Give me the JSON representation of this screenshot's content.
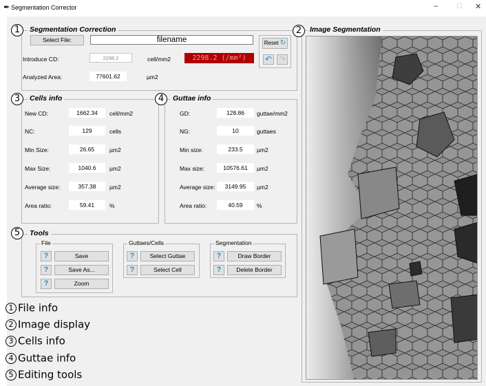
{
  "window": {
    "title": "Segmentation Corrector",
    "minimize": "–",
    "maximize": "□",
    "close": "✕"
  },
  "segmentation": {
    "title": "Segmentation Correction",
    "select_file": "Select File:",
    "filename": "filename",
    "introduce_cd_label": "Introduce CD:",
    "cd_placeholder": "2298.2",
    "cd_unit": "cell/mm2",
    "cd_display": "2298.2 (/mm²)",
    "reset": "Reset",
    "analyzed_area_label": "Analyzed Area:",
    "analyzed_area_value": "77601.62",
    "analyzed_area_unit": "µm2"
  },
  "cells": {
    "title": "Cells info",
    "rows": [
      {
        "label": "New CD:",
        "value": "1662.34",
        "unit": "cell/mm2"
      },
      {
        "label": "NC:",
        "value": "129",
        "unit": "cells"
      },
      {
        "label": "Min Size:",
        "value": "26.65",
        "unit": "µm2"
      },
      {
        "label": "Max Size:",
        "value": "1040.6",
        "unit": "µm2"
      },
      {
        "label": "Average size:",
        "value": "357.38",
        "unit": "µm2"
      },
      {
        "label": "Area ratio:",
        "value": "59.41",
        "unit": "%"
      }
    ]
  },
  "guttae": {
    "title": "Guttae info",
    "rows": [
      {
        "label": "GD:",
        "value": "128.86",
        "unit": "guttae/mm2"
      },
      {
        "label": "NG:",
        "value": "10",
        "unit": "guttaes"
      },
      {
        "label": "Min size:",
        "value": "233.5",
        "unit": "µm2"
      },
      {
        "label": "Max size:",
        "value": "10576.61",
        "unit": "µm2"
      },
      {
        "label": "Average size:",
        "value": "3149.95",
        "unit": "µm2"
      },
      {
        "label": "Area ratio:",
        "value": "40.59",
        "unit": "%"
      }
    ]
  },
  "tools": {
    "title": "Tools",
    "file_group": "File",
    "save": "Save",
    "save_as": "Save As...",
    "zoom": "Zoom",
    "gc_group": "Guttaes/Cells",
    "select_guttae": "Select Guttae",
    "select_cell": "Select Cell",
    "seg_group": "Segmentation",
    "draw_border": "Draw Border",
    "delete_border": "Delete Border",
    "help": "?"
  },
  "image_panel": {
    "title": "Image Segmentation"
  },
  "markers": [
    "1",
    "2",
    "3",
    "4",
    "5"
  ],
  "legend": [
    {
      "num": "1",
      "text": "File info"
    },
    {
      "num": "2",
      "text": "Image display"
    },
    {
      "num": "3",
      "text": "Cells info"
    },
    {
      "num": "4",
      "text": "Guttae info"
    },
    {
      "num": "5",
      "text": "Editing tools"
    }
  ],
  "colors": {
    "cd_display_bg": "#b00000",
    "help_icon": "#1a8fd8",
    "window_bg": "#f0f0f0"
  }
}
